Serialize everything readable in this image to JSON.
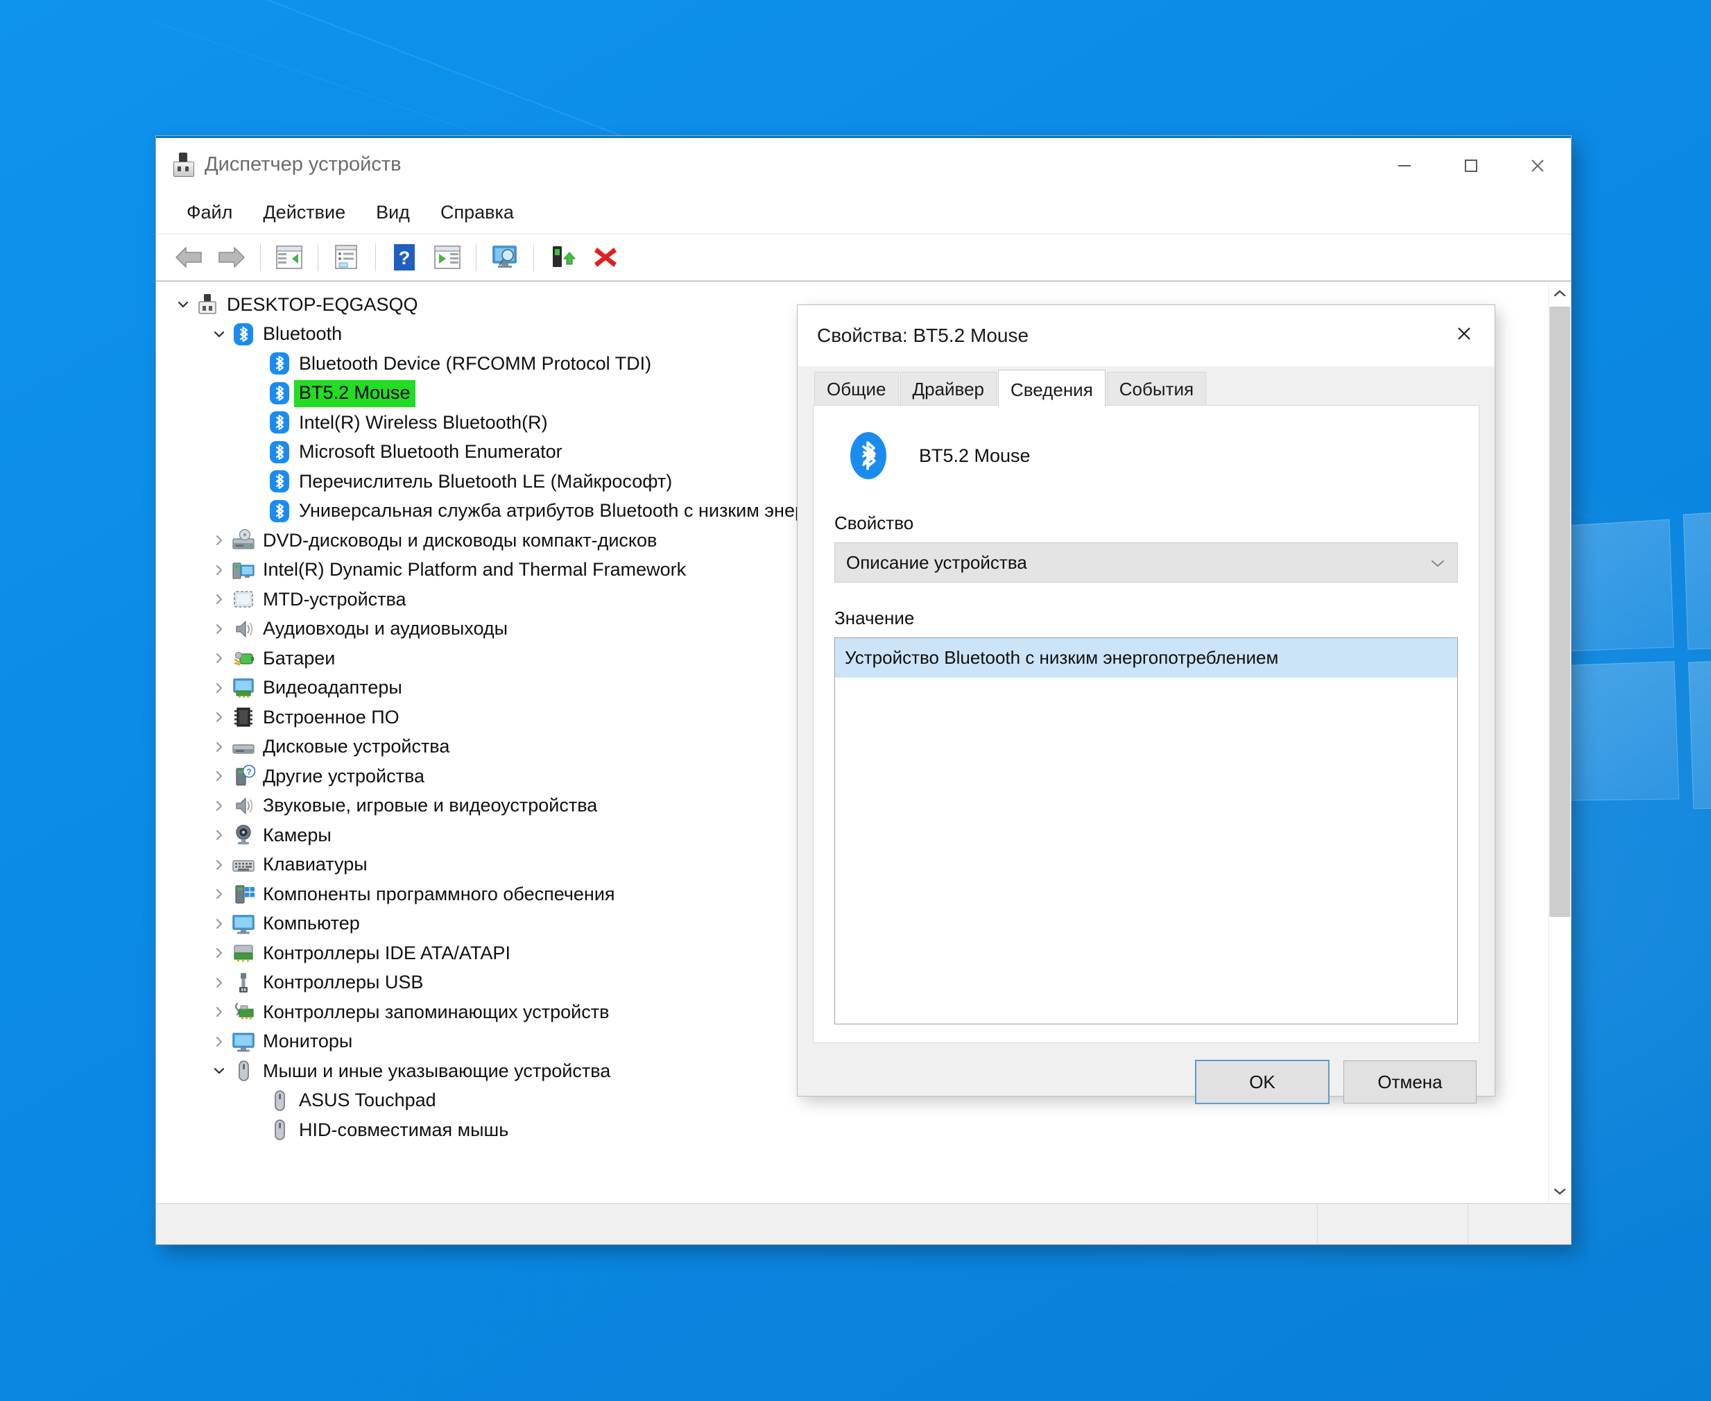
{
  "window": {
    "title": "Диспетчер устройств",
    "icon": "device-plug-icon",
    "controls": {
      "minimize": "minimize-icon",
      "maximize": "maximize-icon",
      "close": "close-icon"
    }
  },
  "menubar": {
    "items": [
      {
        "label": "Файл"
      },
      {
        "label": "Действие"
      },
      {
        "label": "Вид"
      },
      {
        "label": "Справка"
      }
    ]
  },
  "toolbar": {
    "buttons": [
      {
        "name": "back-arrow-icon"
      },
      {
        "name": "forward-arrow-icon"
      },
      {
        "name": "show-hide-console-tree-icon"
      },
      {
        "name": "properties-icon"
      },
      {
        "name": "help-icon"
      },
      {
        "name": "update-driver-icon"
      },
      {
        "name": "scan-for-hardware-changes-icon"
      },
      {
        "name": "uninstall-device-icon"
      },
      {
        "name": "disable-device-icon"
      }
    ]
  },
  "tree": {
    "rows": [
      {
        "label": "DESKTOP-EQGASQQ",
        "depth": 0,
        "twisty": "expanded",
        "icon": "computer-plug-icon"
      },
      {
        "label": "Bluetooth",
        "depth": 1,
        "twisty": "expanded",
        "icon": "bluetooth-icon"
      },
      {
        "label": "Bluetooth Device (RFCOMM Protocol TDI)",
        "depth": 2,
        "twisty": "none",
        "icon": "bluetooth-icon"
      },
      {
        "label": "BT5.2 Mouse",
        "depth": 2,
        "twisty": "none",
        "icon": "bluetooth-icon",
        "highlight": true
      },
      {
        "label": "Intel(R) Wireless Bluetooth(R)",
        "depth": 2,
        "twisty": "none",
        "icon": "bluetooth-icon"
      },
      {
        "label": "Microsoft Bluetooth Enumerator",
        "depth": 2,
        "twisty": "none",
        "icon": "bluetooth-icon"
      },
      {
        "label": "Перечислитель Bluetooth LE (Майкрософт)",
        "depth": 2,
        "twisty": "none",
        "icon": "bluetooth-icon"
      },
      {
        "label": "Универсальная служба атрибутов Bluetooth с низким энергопотреблением",
        "depth": 2,
        "twisty": "none",
        "icon": "bluetooth-icon"
      },
      {
        "label": "DVD-дисководы и дисководы компакт-дисков",
        "depth": 1,
        "twisty": "collapsed",
        "icon": "dvd-drive-icon"
      },
      {
        "label": "Intel(R) Dynamic Platform and Thermal Framework",
        "depth": 1,
        "twisty": "collapsed",
        "icon": "system-device-icon"
      },
      {
        "label": "MTD-устройства",
        "depth": 1,
        "twisty": "collapsed",
        "icon": "mtd-device-icon"
      },
      {
        "label": "Аудиовходы и аудиовыходы",
        "depth": 1,
        "twisty": "collapsed",
        "icon": "speaker-icon"
      },
      {
        "label": "Батареи",
        "depth": 1,
        "twisty": "collapsed",
        "icon": "battery-icon"
      },
      {
        "label": "Видеоадаптеры",
        "depth": 1,
        "twisty": "collapsed",
        "icon": "display-adapter-icon"
      },
      {
        "label": "Встроенное ПО",
        "depth": 1,
        "twisty": "collapsed",
        "icon": "firmware-chip-icon"
      },
      {
        "label": "Дисковые устройства",
        "depth": 1,
        "twisty": "collapsed",
        "icon": "disk-drive-icon"
      },
      {
        "label": "Другие устройства",
        "depth": 1,
        "twisty": "collapsed",
        "icon": "unknown-device-icon"
      },
      {
        "label": "Звуковые, игровые и видеоустройства",
        "depth": 1,
        "twisty": "collapsed",
        "icon": "speaker-icon"
      },
      {
        "label": "Камеры",
        "depth": 1,
        "twisty": "collapsed",
        "icon": "camera-icon"
      },
      {
        "label": "Клавиатуры",
        "depth": 1,
        "twisty": "collapsed",
        "icon": "keyboard-icon"
      },
      {
        "label": "Компоненты программного обеспечения",
        "depth": 1,
        "twisty": "collapsed",
        "icon": "software-component-icon"
      },
      {
        "label": "Компьютер",
        "depth": 1,
        "twisty": "collapsed",
        "icon": "monitor-icon"
      },
      {
        "label": "Контроллеры IDE ATA/ATAPI",
        "depth": 1,
        "twisty": "collapsed",
        "icon": "ide-controller-icon"
      },
      {
        "label": "Контроллеры USB",
        "depth": 1,
        "twisty": "collapsed",
        "icon": "usb-icon"
      },
      {
        "label": "Контроллеры запоминающих устройств",
        "depth": 1,
        "twisty": "collapsed",
        "icon": "storage-controller-icon"
      },
      {
        "label": "Мониторы",
        "depth": 1,
        "twisty": "collapsed",
        "icon": "monitor-icon"
      },
      {
        "label": "Мыши и иные указывающие устройства",
        "depth": 1,
        "twisty": "expanded",
        "icon": "mouse-icon"
      },
      {
        "label": "ASUS Touchpad",
        "depth": 2,
        "twisty": "none",
        "icon": "mouse-icon"
      },
      {
        "label": "HID-совместимая мышь",
        "depth": 2,
        "twisty": "none",
        "icon": "mouse-icon"
      }
    ],
    "scrollbar": {
      "up_icon": "chevron-up-icon",
      "down_icon": "chevron-down-icon"
    }
  },
  "statusbar": {
    "text": ""
  },
  "dialog": {
    "title": "Свойства: BT5.2 Mouse",
    "close_icon": "close-icon",
    "tabs": [
      {
        "label": "Общие",
        "active": false
      },
      {
        "label": "Драйвер",
        "active": false
      },
      {
        "label": "Сведения",
        "active": true
      },
      {
        "label": "События",
        "active": false
      }
    ],
    "device_name": "BT5.2 Mouse",
    "device_icon": "bluetooth-icon",
    "property_label": "Свойство",
    "property_value": "Описание устройства",
    "property_dropdown_icon": "chevron-down-icon",
    "value_label": "Значение",
    "value_items": [
      "Устройство Bluetooth с низким энергопотреблением"
    ],
    "buttons": {
      "ok": "OK",
      "cancel": "Отмена"
    }
  },
  "colors": {
    "accent": "#0078d7",
    "highlight_green": "#22dd22",
    "selection_blue": "#cce4f7",
    "bluetooth_blue": "#1a8cf0",
    "desktop_blue": "#0a8fe8"
  }
}
